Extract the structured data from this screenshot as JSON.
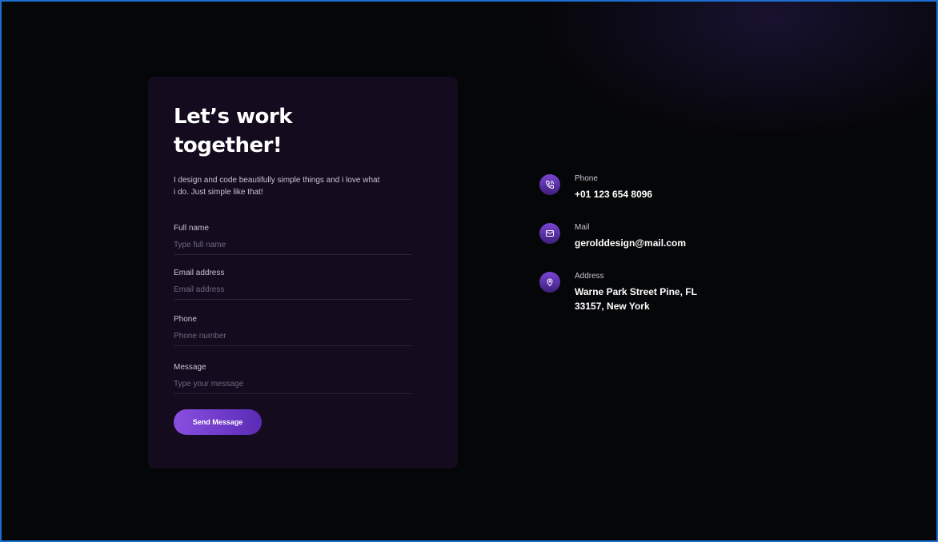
{
  "form": {
    "title": "Let’s work together!",
    "intro": "I design and code beautifully simple things and i love what i do. Just simple like that!",
    "fields": [
      {
        "label": "Full name",
        "placeholder": "Type full name",
        "value": ""
      },
      {
        "label": "Email address",
        "placeholder": "Email address",
        "value": ""
      },
      {
        "label": "Phone",
        "placeholder": "Phone number",
        "value": ""
      },
      {
        "label": "Message",
        "placeholder": "Type your message",
        "value": ""
      }
    ],
    "submit_label": "Send Message"
  },
  "contact": {
    "items": [
      {
        "icon": "phone-icon",
        "label": "Phone",
        "value": "+01 123 654 8096"
      },
      {
        "icon": "mail-icon",
        "label": "Mail",
        "value": "gerolddesign@mail.com"
      },
      {
        "icon": "location-pin-icon",
        "label": "Address",
        "value": "Warne Park Street Pine, FL 33157, New York"
      }
    ]
  },
  "colors": {
    "background": "#050608",
    "card": "#140c1e",
    "accent": "#8a4fe0",
    "accent_dark": "#5a2bb5",
    "frame_border": "#1c6fd0"
  }
}
